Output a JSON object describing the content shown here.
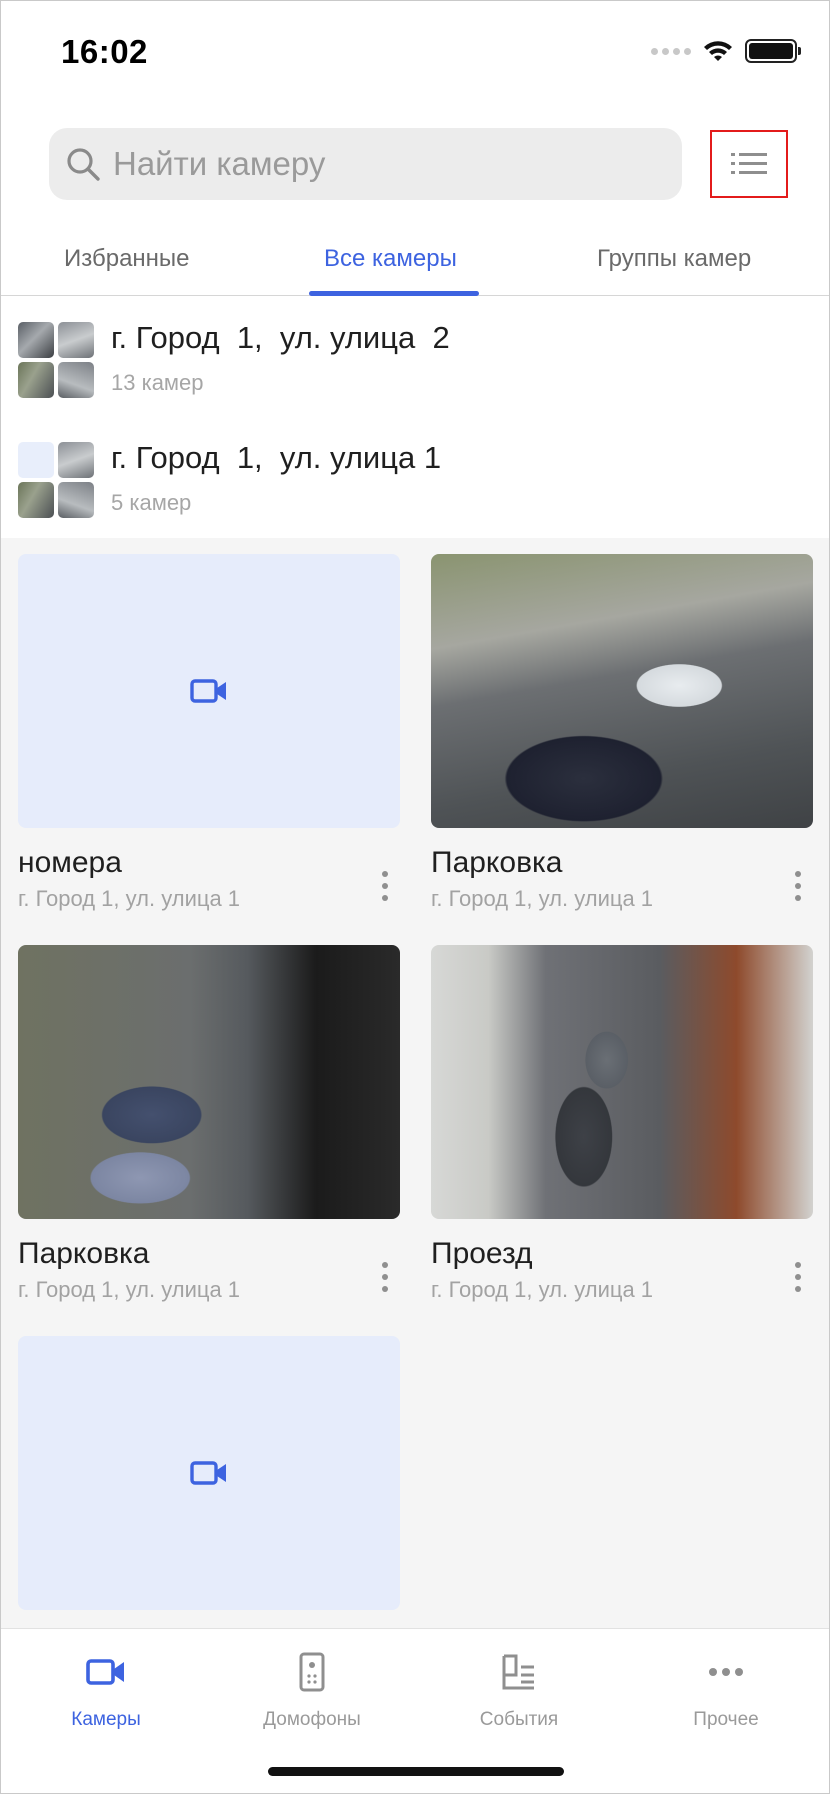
{
  "status_bar": {
    "time": "16:02"
  },
  "search": {
    "placeholder": "Найти камеру"
  },
  "tabs": [
    {
      "label": "Избранные",
      "active": false
    },
    {
      "label": "Все камеры",
      "active": true
    },
    {
      "label": "Группы камер",
      "active": false
    }
  ],
  "groups": [
    {
      "title": "г. Город  1,  ул. улица  2",
      "count": "13 камер"
    },
    {
      "title": "г. Город  1,  ул. улица 1",
      "count": "5 камер"
    }
  ],
  "cameras": [
    {
      "name": "номера",
      "address": "г. Город 1, ул. улица 1",
      "preview": "placeholder-video-icon"
    },
    {
      "name": "Парковка",
      "address": "г. Город 1, ул. улица 1",
      "preview": "parking-lot-photo"
    },
    {
      "name": "Парковка",
      "address": "г. Город 1, ул. улица 1",
      "preview": "parking-lot-photo"
    },
    {
      "name": "Проезд",
      "address": "г. Город 1, ул. улица 1",
      "preview": "driveway-photo"
    },
    {
      "name": "",
      "address": "",
      "preview": "placeholder-video-icon"
    }
  ],
  "bottom_nav": [
    {
      "label": "Камеры",
      "icon": "camera-icon",
      "active": true
    },
    {
      "label": "Домофоны",
      "icon": "intercom-icon",
      "active": false
    },
    {
      "label": "События",
      "icon": "events-icon",
      "active": false
    },
    {
      "label": "Прочее",
      "icon": "more-icon",
      "active": false
    }
  ],
  "colors": {
    "accent": "#3d63e0",
    "highlight_border": "#e31b1b",
    "placeholder_bg": "#e6ecfb"
  }
}
